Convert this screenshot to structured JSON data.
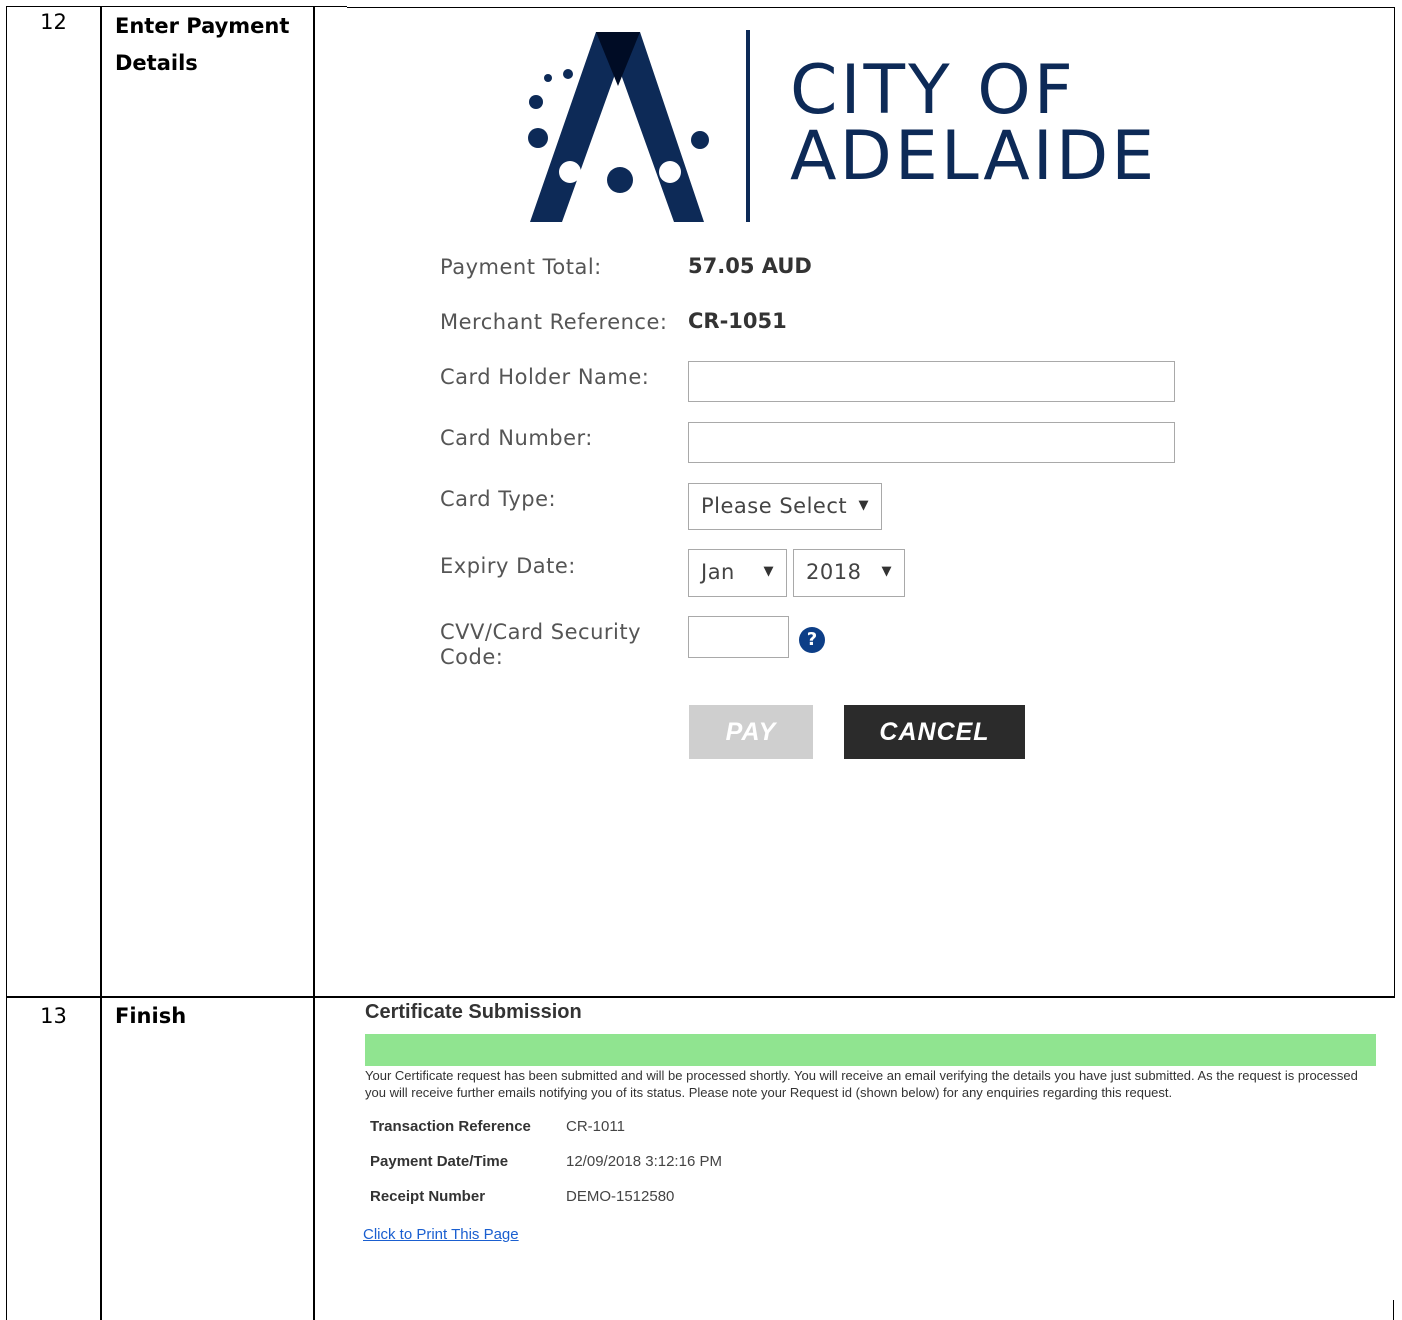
{
  "rows": [
    {
      "number": "12",
      "step": "Enter Payment Details"
    },
    {
      "number": "13",
      "step": "Finish"
    }
  ],
  "logo": {
    "line1": "CITY OF",
    "line2": "ADELAIDE",
    "brand_color": "#0d2a57"
  },
  "payment": {
    "total_label": "Payment Total:",
    "total_value": "57.05 AUD",
    "merchant_label": "Merchant Reference:",
    "merchant_value": "CR-1051",
    "holder_label": "Card Holder Name:",
    "holder_value": "",
    "number_label": "Card Number:",
    "number_value": "",
    "type_label": "Card Type:",
    "type_selected": "Please Select",
    "expiry_label": "Expiry Date:",
    "expiry_month": "Jan",
    "expiry_year": "2018",
    "cvv_label": "CVV/Card Security Code:",
    "cvv_value": "",
    "help_icon": "?",
    "pay_label": "PAY",
    "cancel_label": "CANCEL",
    "dropdown_arrow": "▼"
  },
  "finish": {
    "title": "Certificate Submission",
    "status_color": "#90e490",
    "message": "Your Certificate request has been submitted and will be processed shortly. You will receive an email verifying the details you have just submitted. As the request is processed you will receive further emails notifying you of its status. Please note your Request id (shown below) for any enquiries regarding this request.",
    "details": [
      {
        "label": "Transaction Reference",
        "value": "CR-1011"
      },
      {
        "label": "Payment Date/Time",
        "value": "12/09/2018 3:12:16 PM"
      },
      {
        "label": "Receipt Number",
        "value": "DEMO-1512580"
      }
    ],
    "print_link": "Click to Print This Page"
  }
}
